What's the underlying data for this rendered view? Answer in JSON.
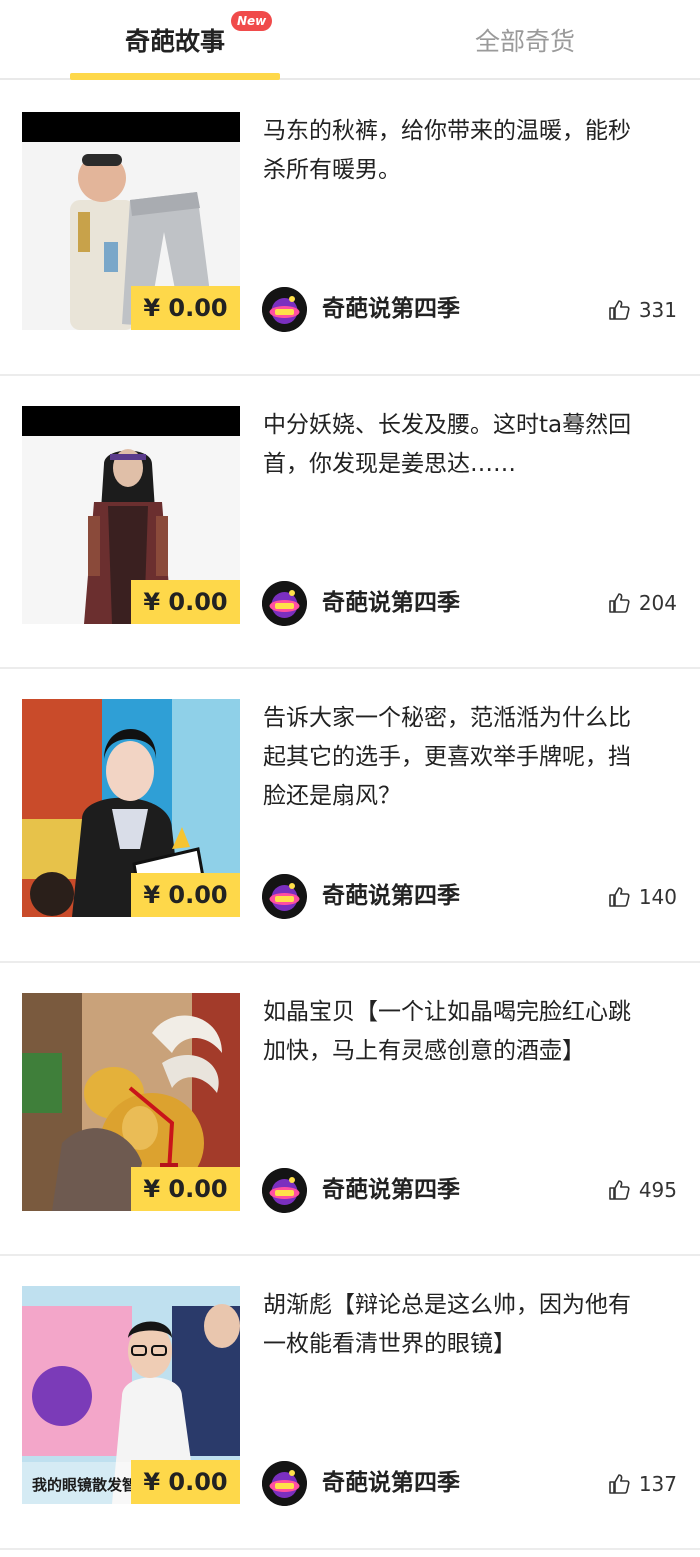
{
  "tabs": [
    {
      "label": "奇葩故事",
      "badge": "New",
      "active": true
    },
    {
      "label": "全部奇货",
      "active": false
    }
  ],
  "colors": {
    "accent": "#fed84a",
    "badge": "#f04b4b",
    "muted_tab": "#9a9a9a"
  },
  "items": [
    {
      "title": "马东的秋裤，给你带来的温暖，能秒杀所有暖男。",
      "price": "¥ 0.00",
      "author": "奇葩说第四季",
      "likes": "331",
      "image": "man-holding-gray-pants"
    },
    {
      "title": "中分妖娆、长发及腰。这时ta蓦然回首，你发现是姜思达……",
      "price": "¥ 0.00",
      "author": "奇葩说第四季",
      "likes": "204",
      "image": "long-haired-person-in-coat"
    },
    {
      "title": "告诉大家一个秘密，范湉湉为什么比起其它的选手，更喜欢举手牌呢，挡脸还是扇风？",
      "price": "¥ 0.00",
      "author": "奇葩说第四季",
      "likes": "140",
      "image": "woman-with-hand-sign"
    },
    {
      "title": "如晶宝贝【一个让如晶喝完脸红心跳加快，马上有灵感创意的酒壶】",
      "price": "¥ 0.00",
      "author": "奇葩说第四季",
      "likes": "495",
      "image": "gourd-flask-in-hand"
    },
    {
      "title": "胡渐彪【辩论总是这么帅，因为他有一枚能看清世界的眼镜】",
      "price": "¥ 0.00",
      "author": "奇葩说第四季",
      "likes": "137",
      "image": "man-with-glasses",
      "image_caption": "我的眼镜散发智慧的光芒"
    }
  ],
  "icons": {
    "like": "thumbs-up-icon",
    "avatar": "show-logo-avatar"
  }
}
